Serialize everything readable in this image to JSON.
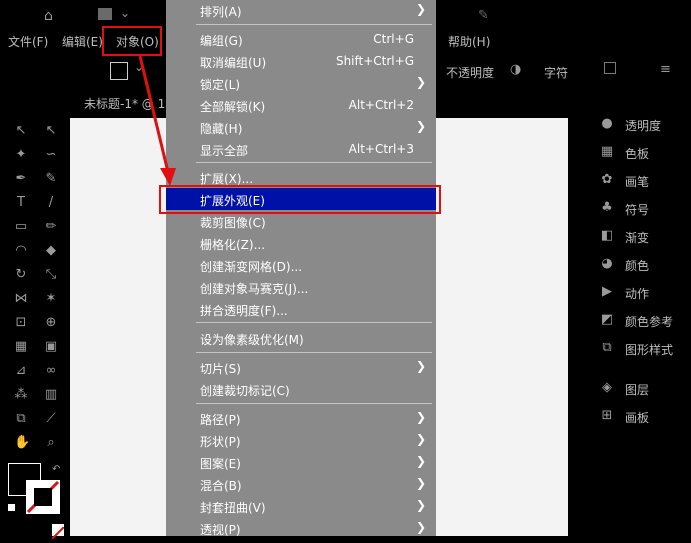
{
  "menubar": {
    "file": "文件(F)",
    "edit": "编辑(E)",
    "object": "对象(O)",
    "help": "帮助(H)"
  },
  "control_bar": {
    "opacity_label": "不透明度",
    "char_label": "字符"
  },
  "document_tab": "未标题-1* @ 1",
  "object_menu": {
    "items": [
      {
        "label": "排列(A)",
        "shortcut": "",
        "submenu": true
      },
      {
        "label": "编组(G)",
        "shortcut": "Ctrl+G",
        "submenu": false
      },
      {
        "label": "取消编组(U)",
        "shortcut": "Shift+Ctrl+G",
        "submenu": false
      },
      {
        "label": "锁定(L)",
        "shortcut": "",
        "submenu": true
      },
      {
        "label": "全部解锁(K)",
        "shortcut": "Alt+Ctrl+2",
        "submenu": false
      },
      {
        "label": "隐藏(H)",
        "shortcut": "",
        "submenu": true
      },
      {
        "label": "显示全部",
        "shortcut": "Alt+Ctrl+3",
        "submenu": false
      },
      {
        "label": "扩展(X)...",
        "shortcut": "",
        "submenu": false
      },
      {
        "label": "扩展外观(E)",
        "shortcut": "",
        "submenu": false,
        "highlighted": true
      },
      {
        "label": "裁剪图像(C)",
        "shortcut": "",
        "submenu": false
      },
      {
        "label": "栅格化(Z)...",
        "shortcut": "",
        "submenu": false
      },
      {
        "label": "创建渐变网格(D)...",
        "shortcut": "",
        "submenu": false
      },
      {
        "label": "创建对象马赛克(J)...",
        "shortcut": "",
        "submenu": false
      },
      {
        "label": "拼合透明度(F)...",
        "shortcut": "",
        "submenu": false
      },
      {
        "label": "设为像素级优化(M)",
        "shortcut": "",
        "submenu": false
      },
      {
        "label": "切片(S)",
        "shortcut": "",
        "submenu": true
      },
      {
        "label": "创建裁切标记(C)",
        "shortcut": "",
        "submenu": false
      },
      {
        "label": "路径(P)",
        "shortcut": "",
        "submenu": true
      },
      {
        "label": "形状(P)",
        "shortcut": "",
        "submenu": true
      },
      {
        "label": "图案(E)",
        "shortcut": "",
        "submenu": true
      },
      {
        "label": "混合(B)",
        "shortcut": "",
        "submenu": true
      },
      {
        "label": "封套扭曲(V)",
        "shortcut": "",
        "submenu": true
      },
      {
        "label": "透视(P)",
        "shortcut": "",
        "submenu": true
      }
    ]
  },
  "right_panel": [
    {
      "label": "透明度",
      "icon": "transparency-icon"
    },
    {
      "label": "色板",
      "icon": "swatches-icon"
    },
    {
      "label": "画笔",
      "icon": "brush-icon"
    },
    {
      "label": "符号",
      "icon": "symbols-icon"
    },
    {
      "label": "渐变",
      "icon": "gradient-icon"
    },
    {
      "label": "颜色",
      "icon": "color-icon"
    },
    {
      "label": "动作",
      "icon": "actions-icon"
    },
    {
      "label": "颜色参考",
      "icon": "color-guide-icon"
    },
    {
      "label": "图形样式",
      "icon": "graphic-styles-icon"
    },
    {
      "label": "图层",
      "icon": "layers-icon"
    },
    {
      "label": "画板",
      "icon": "artboards-icon"
    }
  ],
  "colors": {
    "menu_bg": "#8a8a8a",
    "highlight": "#0011a8",
    "annotation_red": "#e01010",
    "canvas": "#f3f3f3"
  }
}
